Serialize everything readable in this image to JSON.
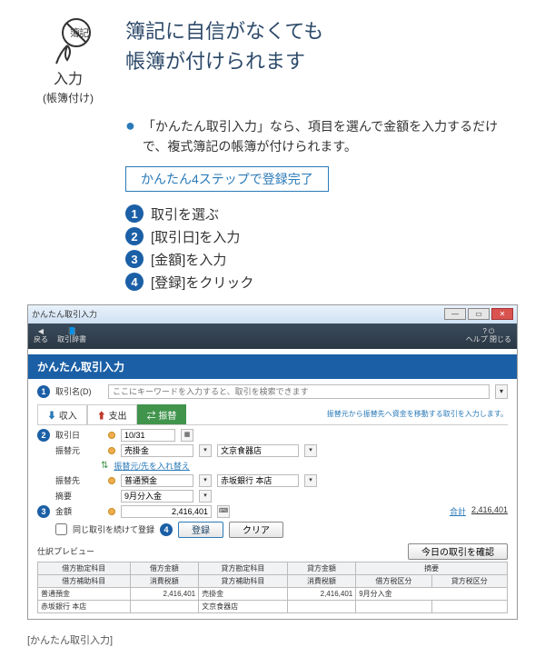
{
  "icon_caption": "入力",
  "icon_sub": "(帳簿付け)",
  "headline_l1": "簿記に自信がなくても",
  "headline_l2": "帳簿が付けられます",
  "bullet_text": "「かんたん取引入力」なら、項目を選んで金額を入力するだけで、複式簿記の帳簿が付けられます。",
  "pill": "かんたん4ステップで登録完了",
  "steps": [
    "取引を選ぶ",
    "[取引日]を入力",
    "[金額]を入力",
    "[登録]をクリック"
  ],
  "caption": "[かんたん取引入力]",
  "win": {
    "title": "かんたん取引入力",
    "tool_back": "戻る",
    "tool_text": "取引辞書",
    "tool_help": "ヘルプ 閉じる",
    "header": "かんたん取引入力",
    "search_label": "取引名(D)",
    "search_ph": "ここにキーワードを入力すると、取引を検索できます",
    "tabs": {
      "income": "収入",
      "expense": "支出",
      "transfer": "振替"
    },
    "hint": "振替元から振替先へ資金を移動する取引を入力します。",
    "row_date_lab": "取引日",
    "row_date_val": "10/31",
    "row_from_lab": "振替元",
    "row_from_type": "売掛金",
    "row_from_acc": "文京食器店",
    "swap": "振替元/先を入れ替え",
    "row_to_lab": "振替先",
    "row_to_type": "普通預金",
    "row_to_acc": "赤坂銀行 本店",
    "row_memo_lab": "摘要",
    "row_memo_val": "9月分入金",
    "row_amount_lab": "金額",
    "row_amount_val": "2,416,401",
    "total_lab": "合計",
    "total_val": "2,416,401",
    "continue": "同じ取引を続けて登録",
    "btn_reg": "登録",
    "btn_clr": "クリア",
    "pv_title": "仕訳プレビュー",
    "btn_today": "今日の取引を確認",
    "th": [
      "借方勘定科目",
      "借方金額",
      "貸方勘定科目",
      "貸方金額",
      "摘要"
    ],
    "th2": [
      "借方補助科目",
      "消費税額",
      "貸方補助科目",
      "消費税額",
      "借方税区分",
      "貸方税区分"
    ],
    "r1": {
      "dr_acc": "普通預金",
      "dr_amt": "2,416,401",
      "cr_acc": "売掛金",
      "cr_amt": "2,416,401",
      "memo": "9月分入金"
    },
    "r2": {
      "dr_sub": "赤坂銀行 本店",
      "cr_sub": "文京食器店"
    }
  }
}
